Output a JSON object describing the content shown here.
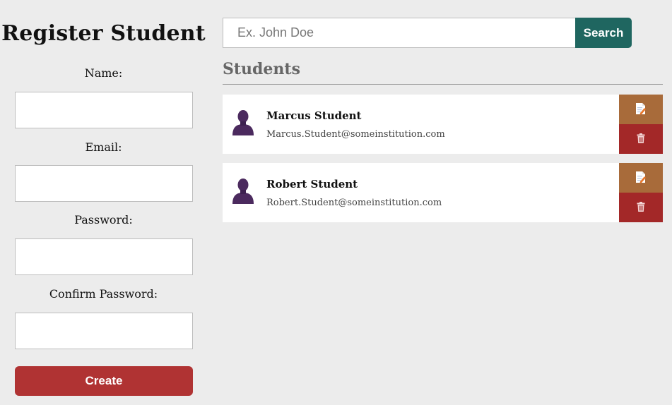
{
  "register": {
    "title": "Register Student",
    "name_label": "Name:",
    "email_label": "Email:",
    "password_label": "Password:",
    "confirm_password_label": "Confirm Password:",
    "create_label": "Create"
  },
  "search": {
    "placeholder": "Ex. John Doe",
    "button_label": "Search"
  },
  "students": {
    "title": "Students",
    "items": [
      {
        "name": "Marcus Student",
        "email": "Marcus.Student@someinstitution.com"
      },
      {
        "name": "Robert Student",
        "email": "Robert.Student@someinstitution.com"
      }
    ]
  },
  "icons": {
    "avatar": "person-icon",
    "edit": "edit-document-icon",
    "delete": "trash-icon"
  },
  "colors": {
    "create_button": "#b03333",
    "search_button": "#1f6660",
    "edit_button": "#a86b3a",
    "delete_button": "#a32828",
    "avatar": "#4b2a5e"
  }
}
